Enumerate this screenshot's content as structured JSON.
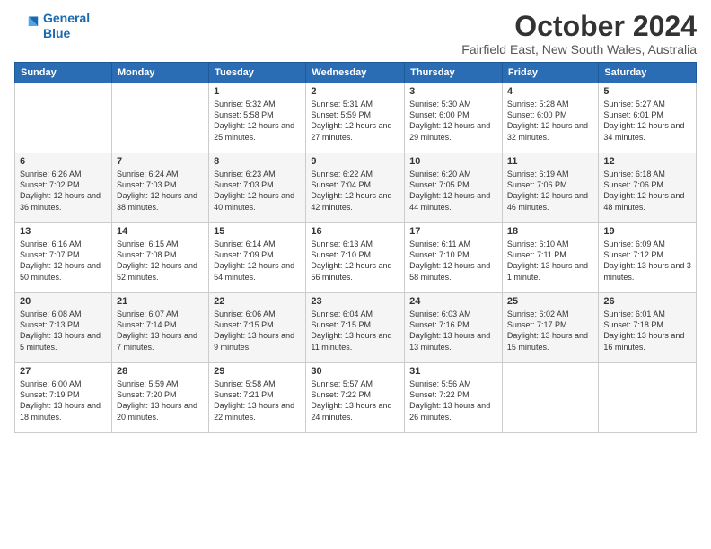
{
  "logo": {
    "line1": "General",
    "line2": "Blue"
  },
  "title": "October 2024",
  "subtitle": "Fairfield East, New South Wales, Australia",
  "days_of_week": [
    "Sunday",
    "Monday",
    "Tuesday",
    "Wednesday",
    "Thursday",
    "Friday",
    "Saturday"
  ],
  "weeks": [
    [
      {
        "day": "",
        "sunrise": "",
        "sunset": "",
        "daylight": ""
      },
      {
        "day": "",
        "sunrise": "",
        "sunset": "",
        "daylight": ""
      },
      {
        "day": "1",
        "sunrise": "Sunrise: 5:32 AM",
        "sunset": "Sunset: 5:58 PM",
        "daylight": "Daylight: 12 hours and 25 minutes."
      },
      {
        "day": "2",
        "sunrise": "Sunrise: 5:31 AM",
        "sunset": "Sunset: 5:59 PM",
        "daylight": "Daylight: 12 hours and 27 minutes."
      },
      {
        "day": "3",
        "sunrise": "Sunrise: 5:30 AM",
        "sunset": "Sunset: 6:00 PM",
        "daylight": "Daylight: 12 hours and 29 minutes."
      },
      {
        "day": "4",
        "sunrise": "Sunrise: 5:28 AM",
        "sunset": "Sunset: 6:00 PM",
        "daylight": "Daylight: 12 hours and 32 minutes."
      },
      {
        "day": "5",
        "sunrise": "Sunrise: 5:27 AM",
        "sunset": "Sunset: 6:01 PM",
        "daylight": "Daylight: 12 hours and 34 minutes."
      }
    ],
    [
      {
        "day": "6",
        "sunrise": "Sunrise: 6:26 AM",
        "sunset": "Sunset: 7:02 PM",
        "daylight": "Daylight: 12 hours and 36 minutes."
      },
      {
        "day": "7",
        "sunrise": "Sunrise: 6:24 AM",
        "sunset": "Sunset: 7:03 PM",
        "daylight": "Daylight: 12 hours and 38 minutes."
      },
      {
        "day": "8",
        "sunrise": "Sunrise: 6:23 AM",
        "sunset": "Sunset: 7:03 PM",
        "daylight": "Daylight: 12 hours and 40 minutes."
      },
      {
        "day": "9",
        "sunrise": "Sunrise: 6:22 AM",
        "sunset": "Sunset: 7:04 PM",
        "daylight": "Daylight: 12 hours and 42 minutes."
      },
      {
        "day": "10",
        "sunrise": "Sunrise: 6:20 AM",
        "sunset": "Sunset: 7:05 PM",
        "daylight": "Daylight: 12 hours and 44 minutes."
      },
      {
        "day": "11",
        "sunrise": "Sunrise: 6:19 AM",
        "sunset": "Sunset: 7:06 PM",
        "daylight": "Daylight: 12 hours and 46 minutes."
      },
      {
        "day": "12",
        "sunrise": "Sunrise: 6:18 AM",
        "sunset": "Sunset: 7:06 PM",
        "daylight": "Daylight: 12 hours and 48 minutes."
      }
    ],
    [
      {
        "day": "13",
        "sunrise": "Sunrise: 6:16 AM",
        "sunset": "Sunset: 7:07 PM",
        "daylight": "Daylight: 12 hours and 50 minutes."
      },
      {
        "day": "14",
        "sunrise": "Sunrise: 6:15 AM",
        "sunset": "Sunset: 7:08 PM",
        "daylight": "Daylight: 12 hours and 52 minutes."
      },
      {
        "day": "15",
        "sunrise": "Sunrise: 6:14 AM",
        "sunset": "Sunset: 7:09 PM",
        "daylight": "Daylight: 12 hours and 54 minutes."
      },
      {
        "day": "16",
        "sunrise": "Sunrise: 6:13 AM",
        "sunset": "Sunset: 7:10 PM",
        "daylight": "Daylight: 12 hours and 56 minutes."
      },
      {
        "day": "17",
        "sunrise": "Sunrise: 6:11 AM",
        "sunset": "Sunset: 7:10 PM",
        "daylight": "Daylight: 12 hours and 58 minutes."
      },
      {
        "day": "18",
        "sunrise": "Sunrise: 6:10 AM",
        "sunset": "Sunset: 7:11 PM",
        "daylight": "Daylight: 13 hours and 1 minute."
      },
      {
        "day": "19",
        "sunrise": "Sunrise: 6:09 AM",
        "sunset": "Sunset: 7:12 PM",
        "daylight": "Daylight: 13 hours and 3 minutes."
      }
    ],
    [
      {
        "day": "20",
        "sunrise": "Sunrise: 6:08 AM",
        "sunset": "Sunset: 7:13 PM",
        "daylight": "Daylight: 13 hours and 5 minutes."
      },
      {
        "day": "21",
        "sunrise": "Sunrise: 6:07 AM",
        "sunset": "Sunset: 7:14 PM",
        "daylight": "Daylight: 13 hours and 7 minutes."
      },
      {
        "day": "22",
        "sunrise": "Sunrise: 6:06 AM",
        "sunset": "Sunset: 7:15 PM",
        "daylight": "Daylight: 13 hours and 9 minutes."
      },
      {
        "day": "23",
        "sunrise": "Sunrise: 6:04 AM",
        "sunset": "Sunset: 7:15 PM",
        "daylight": "Daylight: 13 hours and 11 minutes."
      },
      {
        "day": "24",
        "sunrise": "Sunrise: 6:03 AM",
        "sunset": "Sunset: 7:16 PM",
        "daylight": "Daylight: 13 hours and 13 minutes."
      },
      {
        "day": "25",
        "sunrise": "Sunrise: 6:02 AM",
        "sunset": "Sunset: 7:17 PM",
        "daylight": "Daylight: 13 hours and 15 minutes."
      },
      {
        "day": "26",
        "sunrise": "Sunrise: 6:01 AM",
        "sunset": "Sunset: 7:18 PM",
        "daylight": "Daylight: 13 hours and 16 minutes."
      }
    ],
    [
      {
        "day": "27",
        "sunrise": "Sunrise: 6:00 AM",
        "sunset": "Sunset: 7:19 PM",
        "daylight": "Daylight: 13 hours and 18 minutes."
      },
      {
        "day": "28",
        "sunrise": "Sunrise: 5:59 AM",
        "sunset": "Sunset: 7:20 PM",
        "daylight": "Daylight: 13 hours and 20 minutes."
      },
      {
        "day": "29",
        "sunrise": "Sunrise: 5:58 AM",
        "sunset": "Sunset: 7:21 PM",
        "daylight": "Daylight: 13 hours and 22 minutes."
      },
      {
        "day": "30",
        "sunrise": "Sunrise: 5:57 AM",
        "sunset": "Sunset: 7:22 PM",
        "daylight": "Daylight: 13 hours and 24 minutes."
      },
      {
        "day": "31",
        "sunrise": "Sunrise: 5:56 AM",
        "sunset": "Sunset: 7:22 PM",
        "daylight": "Daylight: 13 hours and 26 minutes."
      },
      {
        "day": "",
        "sunrise": "",
        "sunset": "",
        "daylight": ""
      },
      {
        "day": "",
        "sunrise": "",
        "sunset": "",
        "daylight": ""
      }
    ]
  ]
}
